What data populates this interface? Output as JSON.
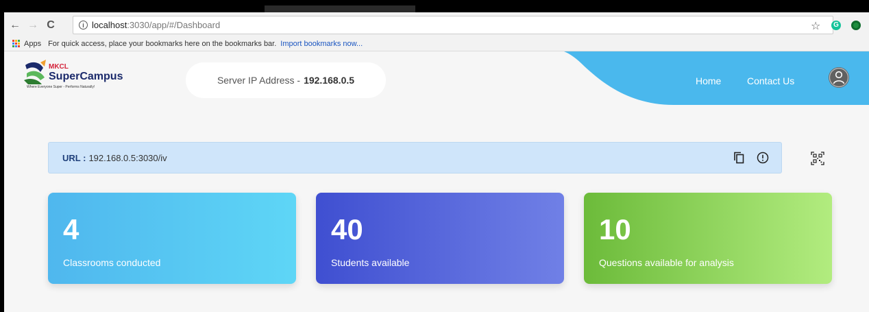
{
  "browser": {
    "nav": {
      "back": "←",
      "forward": "→",
      "reload": "C"
    },
    "address": {
      "host": "localhost",
      "path": ":3030/app/#/Dashboard"
    },
    "bookmarks": {
      "apps_label": "Apps",
      "hint": "For quick access, place your bookmarks here on the bookmarks bar.",
      "import_link": "Import bookmarks now..."
    }
  },
  "header": {
    "logo": {
      "brand_small": "MKCL",
      "brand": "SuperCampus",
      "tagline": "Where Everyone Super - Performs Naturally!"
    },
    "server": {
      "label": "Server IP Address - ",
      "ip": "192.168.0.5"
    },
    "nav": {
      "home": "Home",
      "contact": "Contact Us"
    }
  },
  "url_bar": {
    "label": "URL :",
    "value": "192.168.0.5:3030/iv"
  },
  "cards": [
    {
      "value": "4",
      "label": "Classrooms conducted"
    },
    {
      "value": "40",
      "label": "Students available"
    },
    {
      "value": "10",
      "label": "Questions available for analysis"
    }
  ],
  "colors": {
    "header_accent": "#4ab8ed",
    "url_bar_bg": "#cfe5fa"
  },
  "icons": [
    "back-arrow-icon",
    "forward-arrow-icon",
    "reload-icon",
    "info-icon",
    "star-icon",
    "grammarly-icon",
    "extension-icon",
    "apps-grid-icon",
    "user-avatar-icon",
    "copy-icon",
    "alert-circle-icon",
    "qr-code-icon"
  ]
}
